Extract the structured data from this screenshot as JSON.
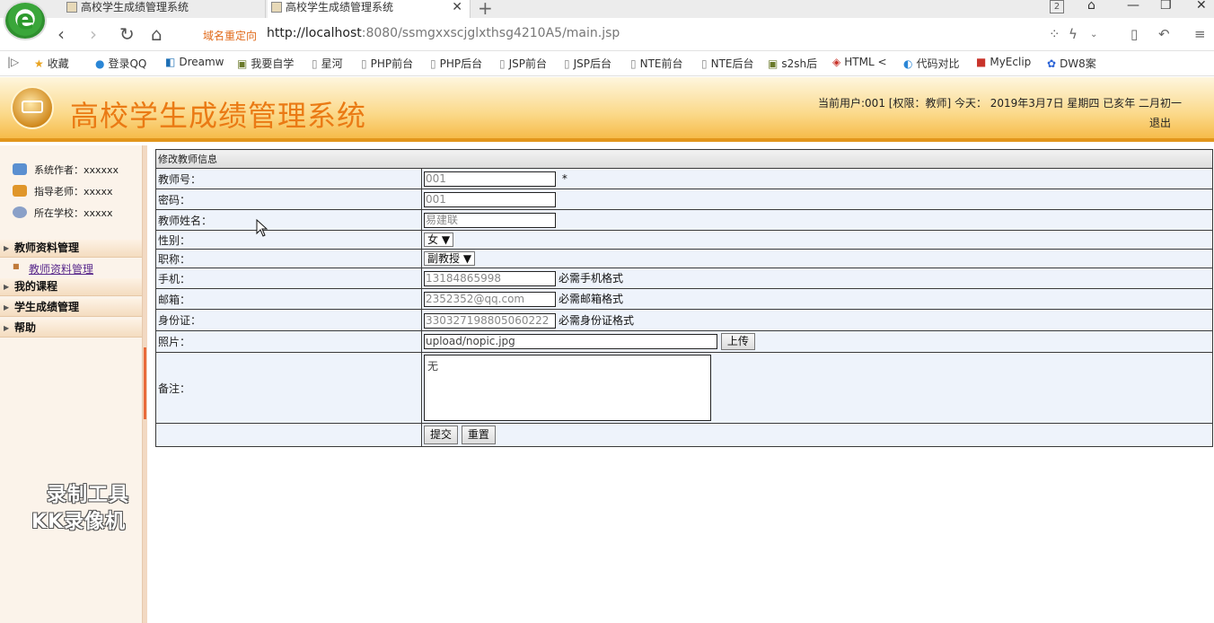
{
  "browser": {
    "tabs": [
      {
        "title": "高校学生成绩管理系统",
        "active": false
      },
      {
        "title": "高校学生成绩管理系统",
        "active": true
      }
    ],
    "tab_count": "2",
    "redirect_label": "域名重定向",
    "url_host": "http://localhost",
    "url_rest": ":8080/ssmgxxscjglxthsg4210A5/main.jsp",
    "bookmarks": [
      "收藏",
      "登录QQ",
      "Dreamw",
      "我要自学",
      "星河",
      "PHP前台",
      "PHP后台",
      "JSP前台",
      "JSP后台",
      "NTE前台",
      "NTE后台",
      "s2sh后",
      "HTML <",
      "代码对比",
      "MyEclip",
      "DW8案"
    ]
  },
  "header": {
    "title": "高校学生成绩管理系统",
    "user_info": "当前用户:001 [权限：教师] 今天： 2019年3月7日 星期四 已亥年 二月初一",
    "logout": "退出"
  },
  "sidebar": {
    "info": [
      {
        "label": "系统作者：xxxxxx",
        "icon": "users-icon",
        "color": "#5a8fd0"
      },
      {
        "label": "指导老师：xxxxx",
        "icon": "teacher-icon",
        "color": "#e0962a"
      },
      {
        "label": "所在学校：xxxxx",
        "icon": "school-icon",
        "color": "#8aa0c8"
      }
    ],
    "menus": [
      {
        "label": "教师资料管理"
      },
      {
        "label": "我的课程"
      },
      {
        "label": "学生成绩管理"
      },
      {
        "label": "帮助"
      }
    ],
    "submenu": "教师资料管理",
    "watermark_line1": "录制工具",
    "watermark_line2": "KK录像机"
  },
  "form": {
    "caption": "修改教师信息",
    "teacher_id_label": "教师号：",
    "teacher_id_value": "001",
    "required_mark": "*",
    "password_label": "密码：",
    "password_value": "001",
    "name_label": "教师姓名：",
    "name_value": "易建联",
    "gender_label": "性别：",
    "gender_value": "女",
    "title_label": "职称：",
    "title_value": "副教授",
    "phone_label": "手机：",
    "phone_value": "13184865998",
    "phone_hint": "必需手机格式",
    "email_label": "邮箱：",
    "email_value": "2352352@qq.com",
    "email_hint": "必需邮箱格式",
    "idcard_label": "身份证：",
    "idcard_value": "330327198805060222",
    "idcard_hint": "必需身份证格式",
    "photo_label": "照片：",
    "photo_value": "upload/nopic.jpg",
    "upload_label": "上传",
    "remark_label": "备注：",
    "remark_value": "无",
    "submit_label": "提交",
    "reset_label": "重置"
  },
  "colors": {
    "title": "#ea7a14",
    "header_border": "#e2961c",
    "sidebar_bg": "#fbf3ea",
    "form_bg": "#eef3fb"
  }
}
